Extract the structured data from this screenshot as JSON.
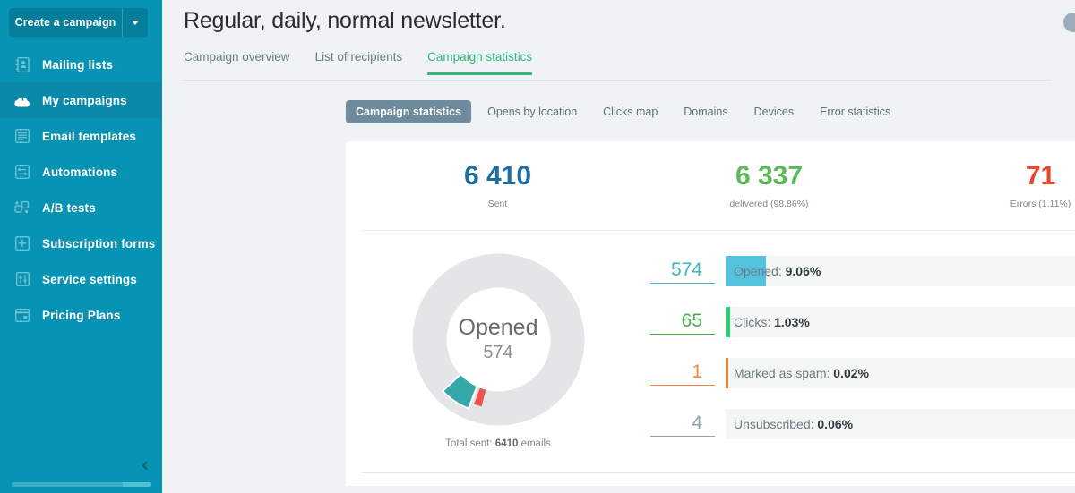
{
  "sidebar": {
    "create_button": {
      "label": "Create a campaign",
      "caret_icon": "chevron-down-icon"
    },
    "items": [
      {
        "label": "Mailing lists",
        "icon": "address-book-icon",
        "active": false
      },
      {
        "label": "My campaigns",
        "icon": "campaign-cloud-icon",
        "active": true
      },
      {
        "label": "Email templates",
        "icon": "template-icon",
        "active": false
      },
      {
        "label": "Automations",
        "icon": "automation-icon",
        "active": false
      },
      {
        "label": "A/B tests",
        "icon": "ab-test-icon",
        "active": false
      },
      {
        "label": "Subscription forms",
        "icon": "form-icon",
        "active": false
      },
      {
        "label": "Service settings",
        "icon": "sliders-icon",
        "active": false
      },
      {
        "label": "Pricing Plans",
        "icon": "pricing-card-icon",
        "active": false
      }
    ],
    "collapse_icon": "chevron-left-icon",
    "progress_percent": 80,
    "bg_color": "#0793b4",
    "active_color": "#0a89a8"
  },
  "header": {
    "title": "Regular, daily, normal newsletter.",
    "help_badge_icon": "help-circle-icon"
  },
  "primary_tabs": [
    {
      "label": "Campaign overview",
      "active": false
    },
    {
      "label": "List of recipients",
      "active": false
    },
    {
      "label": "Campaign statistics",
      "active": true
    }
  ],
  "secondary_tabs": [
    {
      "label": "Campaign statistics",
      "active": true
    },
    {
      "label": "Opens by location",
      "active": false
    },
    {
      "label": "Clicks map",
      "active": false
    },
    {
      "label": "Domains",
      "active": false
    },
    {
      "label": "Devices",
      "active": false
    },
    {
      "label": "Error statistics",
      "active": false
    }
  ],
  "summary": [
    {
      "value": "6 410",
      "caption": "Sent",
      "color": "#1d6f9e"
    },
    {
      "value": "6 337",
      "caption": "delivered (98.86%)",
      "color": "#5bb85b"
    },
    {
      "value": "71",
      "caption": "Errors (1.11%)",
      "color": "#e8432f"
    }
  ],
  "donut": {
    "title": "Opened",
    "subtitle": "574",
    "footer_prefix": "Total sent: ",
    "footer_value": "6410",
    "footer_suffix": " emails"
  },
  "stats": [
    {
      "count": "574",
      "label": "Opened: ",
      "percent": "9.06%",
      "num_color": "#3fb5c7",
      "fill_color": "#55c3dd",
      "fill_percent": 9.06
    },
    {
      "count": "65",
      "label": "Clicks: ",
      "percent": "1.03%",
      "num_color": "#4caf50",
      "fill_color": "#2ecc71",
      "fill_percent": 1.03
    },
    {
      "count": "1",
      "label": "Marked as spam: ",
      "percent": "0.02%",
      "num_color": "#f0883e",
      "fill_color": "#f0883e",
      "fill_percent": 0.08
    },
    {
      "count": "4",
      "label": "Unsubscribed: ",
      "percent": "0.06%",
      "num_color": "#8aa8a6",
      "fill_color": "#8aa8a6",
      "fill_percent": 0.0
    }
  ],
  "chart_data": {
    "type": "pie",
    "title": "Opened",
    "center_value": 574,
    "total_label": "Total sent: 6410 emails",
    "total": 6410,
    "categories": [
      "Opened",
      "Clicks",
      "Remaining"
    ],
    "values": [
      9.06,
      1.03,
      89.91
    ],
    "colors": [
      "#36a8ac",
      "#ef5350",
      "#e2e4e5"
    ],
    "legend": "right",
    "grid": false
  }
}
